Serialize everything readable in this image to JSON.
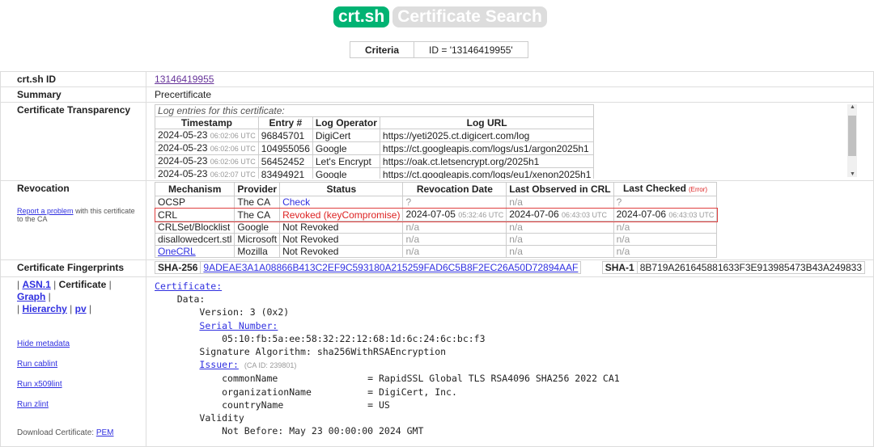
{
  "header": {
    "logo": "crt.sh",
    "title": "Certificate Search"
  },
  "criteria": {
    "label": "Criteria",
    "value": "ID = '13146419955'"
  },
  "id_row": {
    "label": "crt.sh ID",
    "value": "13146419955"
  },
  "summary_row": {
    "label": "Summary",
    "value": "Precertificate"
  },
  "ct": {
    "label": "Certificate Transparency",
    "caption": "Log entries for this certificate:",
    "headers": [
      "Timestamp",
      "Entry #",
      "Log Operator",
      "Log URL"
    ],
    "rows": [
      {
        "date": "2024-05-23",
        "time": "06:02:06 UTC",
        "entry": "96845701",
        "op": "DigiCert",
        "url": "https://yeti2025.ct.digicert.com/log"
      },
      {
        "date": "2024-05-23",
        "time": "06:02:06 UTC",
        "entry": "104955056",
        "op": "Google",
        "url": "https://ct.googleapis.com/logs/us1/argon2025h1"
      },
      {
        "date": "2024-05-23",
        "time": "06:02:06 UTC",
        "entry": "56452452",
        "op": "Let's Encrypt",
        "url": "https://oak.ct.letsencrypt.org/2025h1"
      },
      {
        "date": "2024-05-23",
        "time": "06:02:07 UTC",
        "entry": "83494921",
        "op": "Google",
        "url": "https://ct.googleapis.com/logs/eu1/xenon2025h1"
      }
    ]
  },
  "revocation": {
    "label": "Revocation",
    "report_link": "Report a problem",
    "report_text": "with this certificate to the CA",
    "headers": [
      "Mechanism",
      "Provider",
      "Status",
      "Revocation Date",
      "Last Observed in CRL",
      "Last Checked"
    ],
    "error": "(Error)",
    "rows": [
      {
        "mech": "OCSP",
        "prov": "The CA",
        "status": "Check",
        "rd": "?",
        "rt": "",
        "lo": "n/a",
        "lot": "",
        "lc": "?",
        "lct": ""
      },
      {
        "mech": "CRL",
        "prov": "The CA",
        "status": "Revoked (keyCompromise)",
        "rd": "2024-07-05",
        "rt": "05:32:46 UTC",
        "lo": "2024-07-06",
        "lot": "06:43:03 UTC",
        "lc": "2024-07-06",
        "lct": "06:43:03 UTC"
      },
      {
        "mech": "CRLSet/Blocklist",
        "prov": "Google",
        "status": "Not Revoked",
        "rd": "n/a",
        "rt": "",
        "lo": "n/a",
        "lot": "",
        "lc": "n/a",
        "lct": ""
      },
      {
        "mech": "disallowedcert.stl",
        "prov": "Microsoft",
        "status": "Not Revoked",
        "rd": "n/a",
        "rt": "",
        "lo": "n/a",
        "lot": "",
        "lc": "n/a",
        "lct": ""
      },
      {
        "mech": "OneCRL",
        "prov": "Mozilla",
        "status": "Not Revoked",
        "rd": "n/a",
        "rt": "",
        "lo": "n/a",
        "lot": "",
        "lc": "n/a",
        "lct": ""
      }
    ]
  },
  "fingerprints": {
    "label": "Certificate Fingerprints",
    "sha256_label": "SHA-256",
    "sha256": "9ADEAE3A1A08866B413C2EF9C593180A215259FAD6C5B8F2EC26A50D72894AAF",
    "sha1_label": "SHA-1",
    "sha1": "8B719A261645881633F3E913985473B43A249833"
  },
  "left_nav": {
    "asn1": "ASN.1",
    "certificate": "Certificate",
    "graph": "Graph",
    "hierarchy": "Hierarchy",
    "pv": "pv",
    "hide": "Hide metadata",
    "cablint": "Run cablint",
    "x509lint": "Run x509lint",
    "zlint": "Run zlint",
    "download": "Download Certificate:",
    "pem": "PEM"
  },
  "cert": {
    "certificate": "Certificate:",
    "data": "    Data:",
    "version": "        Version: 3 (0x2)",
    "serial_label": "Serial Number:",
    "serial": "            05:10:fb:5a:ee:58:32:22:12:68:1d:6c:24:6c:bc:f3",
    "sigalg": "        Signature Algorithm: sha256WithRSAEncryption",
    "issuer_label": "Issuer:",
    "ca_id": "(CA ID: 239801)",
    "cn": "            commonName                = RapidSSL Global TLS RSA4096 SHA256 2022 CA1",
    "org": "            organizationName          = DigiCert, Inc.",
    "country": "            countryName               = US",
    "validity": "        Validity",
    "notbefore": "            Not Before: May 23 00:00:00 2024 GMT"
  }
}
